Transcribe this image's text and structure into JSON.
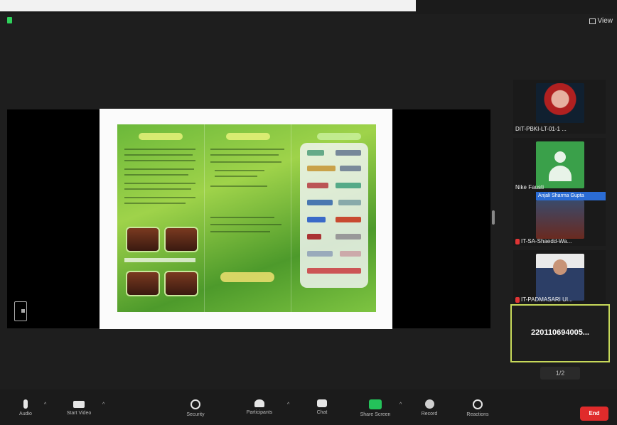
{
  "view_label": "View",
  "participants": [
    {
      "name": "DIT-PBKI-LT-01-1 ..."
    },
    {
      "name": "Nike Fausti"
    },
    {
      "name": "IT-SA-Shaedd-Wa...",
      "overlay": "Anjali Sharma Gupta"
    },
    {
      "name": "IT-PADMASARI UI..."
    }
  ],
  "active_speaker": "220110694005...",
  "page_indicator": "1/2",
  "toolbar": {
    "audio": "Audio",
    "video": "Start Video",
    "security": "Security",
    "participants": "Participants",
    "chat": "Chat",
    "share": "Share Screen",
    "record": "Record",
    "reactions": "Reactions",
    "end": "End"
  },
  "colors": {
    "accent_green": "#24c25a",
    "end_red": "#e02b2b",
    "active_border": "#c7d95a"
  }
}
